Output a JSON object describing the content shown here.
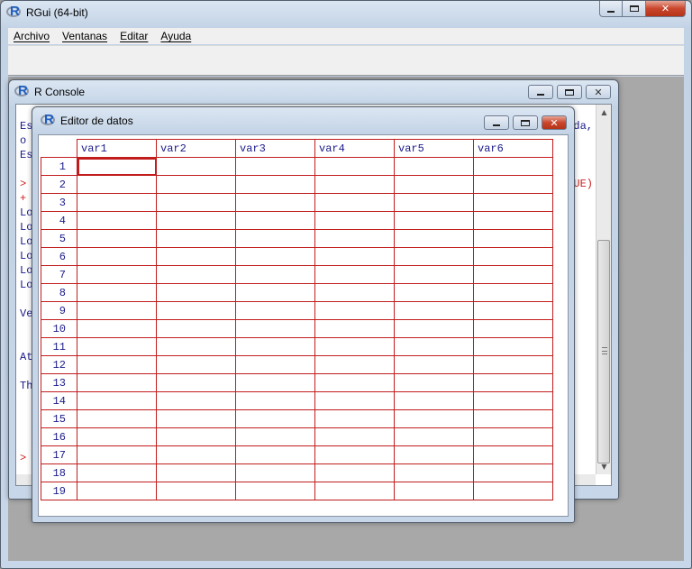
{
  "app": {
    "title": "RGui (64-bit)",
    "menu": [
      "Archivo",
      "Ventanas",
      "Editar",
      "Ayuda"
    ]
  },
  "console": {
    "title": "R Console",
    "left_lines": [
      {
        "text": "",
        "color": "blue"
      },
      {
        "text": "Es",
        "color": "blue"
      },
      {
        "text": "o",
        "color": "blue"
      },
      {
        "text": "Es",
        "color": "blue"
      },
      {
        "text": "",
        "color": "blue"
      },
      {
        "text": ">",
        "color": "red"
      },
      {
        "text": "+",
        "color": "red"
      },
      {
        "text": "Lo",
        "color": "blue"
      },
      {
        "text": "Lo",
        "color": "blue"
      },
      {
        "text": "Lo",
        "color": "blue"
      },
      {
        "text": "Lo",
        "color": "blue"
      },
      {
        "text": "Lo",
        "color": "blue"
      },
      {
        "text": "Lo",
        "color": "blue"
      },
      {
        "text": "",
        "color": "blue"
      },
      {
        "text": "Ve",
        "color": "blue"
      },
      {
        "text": "",
        "color": "blue"
      },
      {
        "text": "",
        "color": "blue"
      },
      {
        "text": "At",
        "color": "blue"
      },
      {
        "text": "",
        "color": "blue"
      },
      {
        "text": "Th",
        "color": "blue"
      },
      {
        "text": "",
        "color": "blue"
      },
      {
        "text": "",
        "color": "blue"
      },
      {
        "text": "",
        "color": "blue"
      },
      {
        "text": "",
        "color": "blue"
      },
      {
        "text": ">",
        "color": "red"
      }
    ],
    "right_lines": [
      {
        "text": "",
        "color": "blue"
      },
      {
        "text": "da,",
        "color": "blue"
      },
      {
        "text": "",
        "color": "blue"
      },
      {
        "text": "",
        "color": "blue"
      },
      {
        "text": "",
        "color": "blue"
      },
      {
        "text": "UE)",
        "color": "red"
      }
    ]
  },
  "editor": {
    "title": "Editor de datos",
    "columns": [
      "var1",
      "var2",
      "var3",
      "var4",
      "var5",
      "var6"
    ],
    "rows": [
      "1",
      "2",
      "3",
      "4",
      "5",
      "6",
      "7",
      "8",
      "9",
      "10",
      "11",
      "12",
      "13",
      "14",
      "15",
      "16",
      "17",
      "18",
      "19"
    ]
  },
  "colors": {
    "grid": "#c21d1d",
    "text_blue": "#1a1a8a",
    "prompt_red": "#cc2020"
  }
}
